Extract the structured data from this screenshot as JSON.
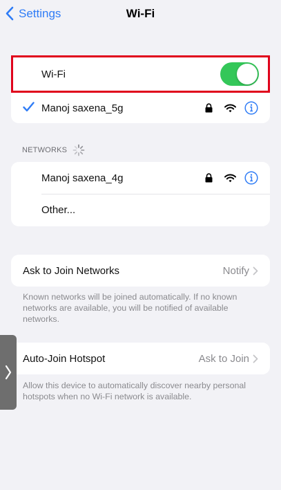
{
  "nav": {
    "back_label": "Settings",
    "title": "Wi-Fi"
  },
  "wifi": {
    "label": "Wi-Fi",
    "enabled": true,
    "toggle_color": "#34c759"
  },
  "connected": {
    "name": "Manoj saxena_5g",
    "secured": true
  },
  "networks": {
    "header": "NETWORKS",
    "items": [
      {
        "name": "Manoj saxena_4g",
        "secured": true
      },
      {
        "name": "Other..."
      }
    ]
  },
  "ask_to_join": {
    "label": "Ask to Join Networks",
    "value": "Notify",
    "footer": "Known networks will be joined automatically. If no known networks are available, you will be notified of available networks."
  },
  "auto_join": {
    "label": "Auto-Join Hotspot",
    "value": "Ask to Join",
    "footer": "Allow this device to automatically discover nearby personal hotspots when no Wi-Fi network is available."
  },
  "colors": {
    "accent": "#2f7cf6",
    "highlight": "#e0001b",
    "background": "#f2f2f6"
  },
  "icons": [
    "chevron-left-icon",
    "checkmark-icon",
    "lock-icon",
    "wifi-icon",
    "info-icon",
    "spinner-icon",
    "chevron-right-icon"
  ]
}
